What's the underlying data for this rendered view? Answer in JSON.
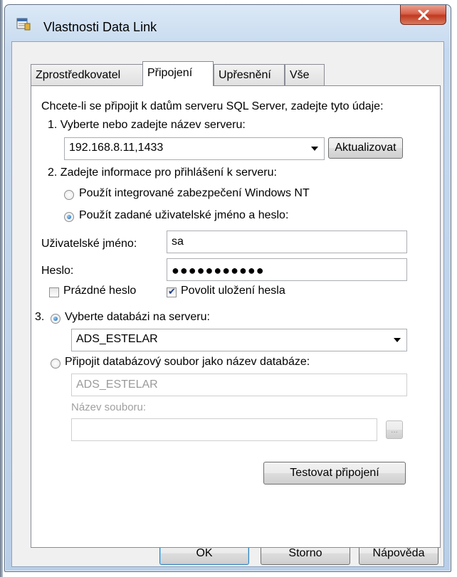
{
  "window": {
    "title": "Vlastnosti Data Link",
    "close_glyph": "x"
  },
  "tabs": [
    {
      "label": "Zprostředkovatel"
    },
    {
      "label": "Připojení"
    },
    {
      "label": "Upřesnění"
    },
    {
      "label": "Vše"
    }
  ],
  "active_tab": "Připojení",
  "intro": "Chcete-li se připojit k datům serveru SQL Server, zadejte tyto údaje:",
  "step1": {
    "label": "1. Vyberte nebo zadejte název serveru:",
    "server_value": "192.168.8.11,1433",
    "refresh_button": "Aktualizovat"
  },
  "step2": {
    "label": "2. Zadejte informace pro přihlášení k serveru:",
    "radio_integrated": "Použít integrované zabezpečení Windows NT",
    "radio_userpass": "Použít zadané uživatelské jméno a heslo:",
    "selected": "userpass",
    "username_label": "Uživatelské jméno:",
    "username_value": "sa",
    "password_label": "Heslo:",
    "password_mask": "●●●●●●●●●●●",
    "blank_password_label": "Prázdné heslo",
    "blank_password_checked": false,
    "allow_save_label": "Povolit uložení hesla",
    "allow_save_checked": true
  },
  "step3": {
    "number": "3.",
    "radio_select_db": "Vyberte databázi na serveru:",
    "database_value": "ADS_ESTELAR",
    "radio_attach": "Připojit databázový soubor jako název databáze:",
    "attach_name_value": "ADS_ESTELAR",
    "filename_label": "Název souboru:",
    "filename_value": "",
    "browse_button": "..."
  },
  "test_button": "Testovat připojení",
  "footer": {
    "ok": "OK",
    "cancel": "Storno",
    "help": "Nápověda"
  },
  "colors": {
    "title_bar": "#c6d9ee",
    "close_button": "#c0391f",
    "panel_bg": "#ffffff",
    "dialog_bg": "#f0f0f0"
  }
}
